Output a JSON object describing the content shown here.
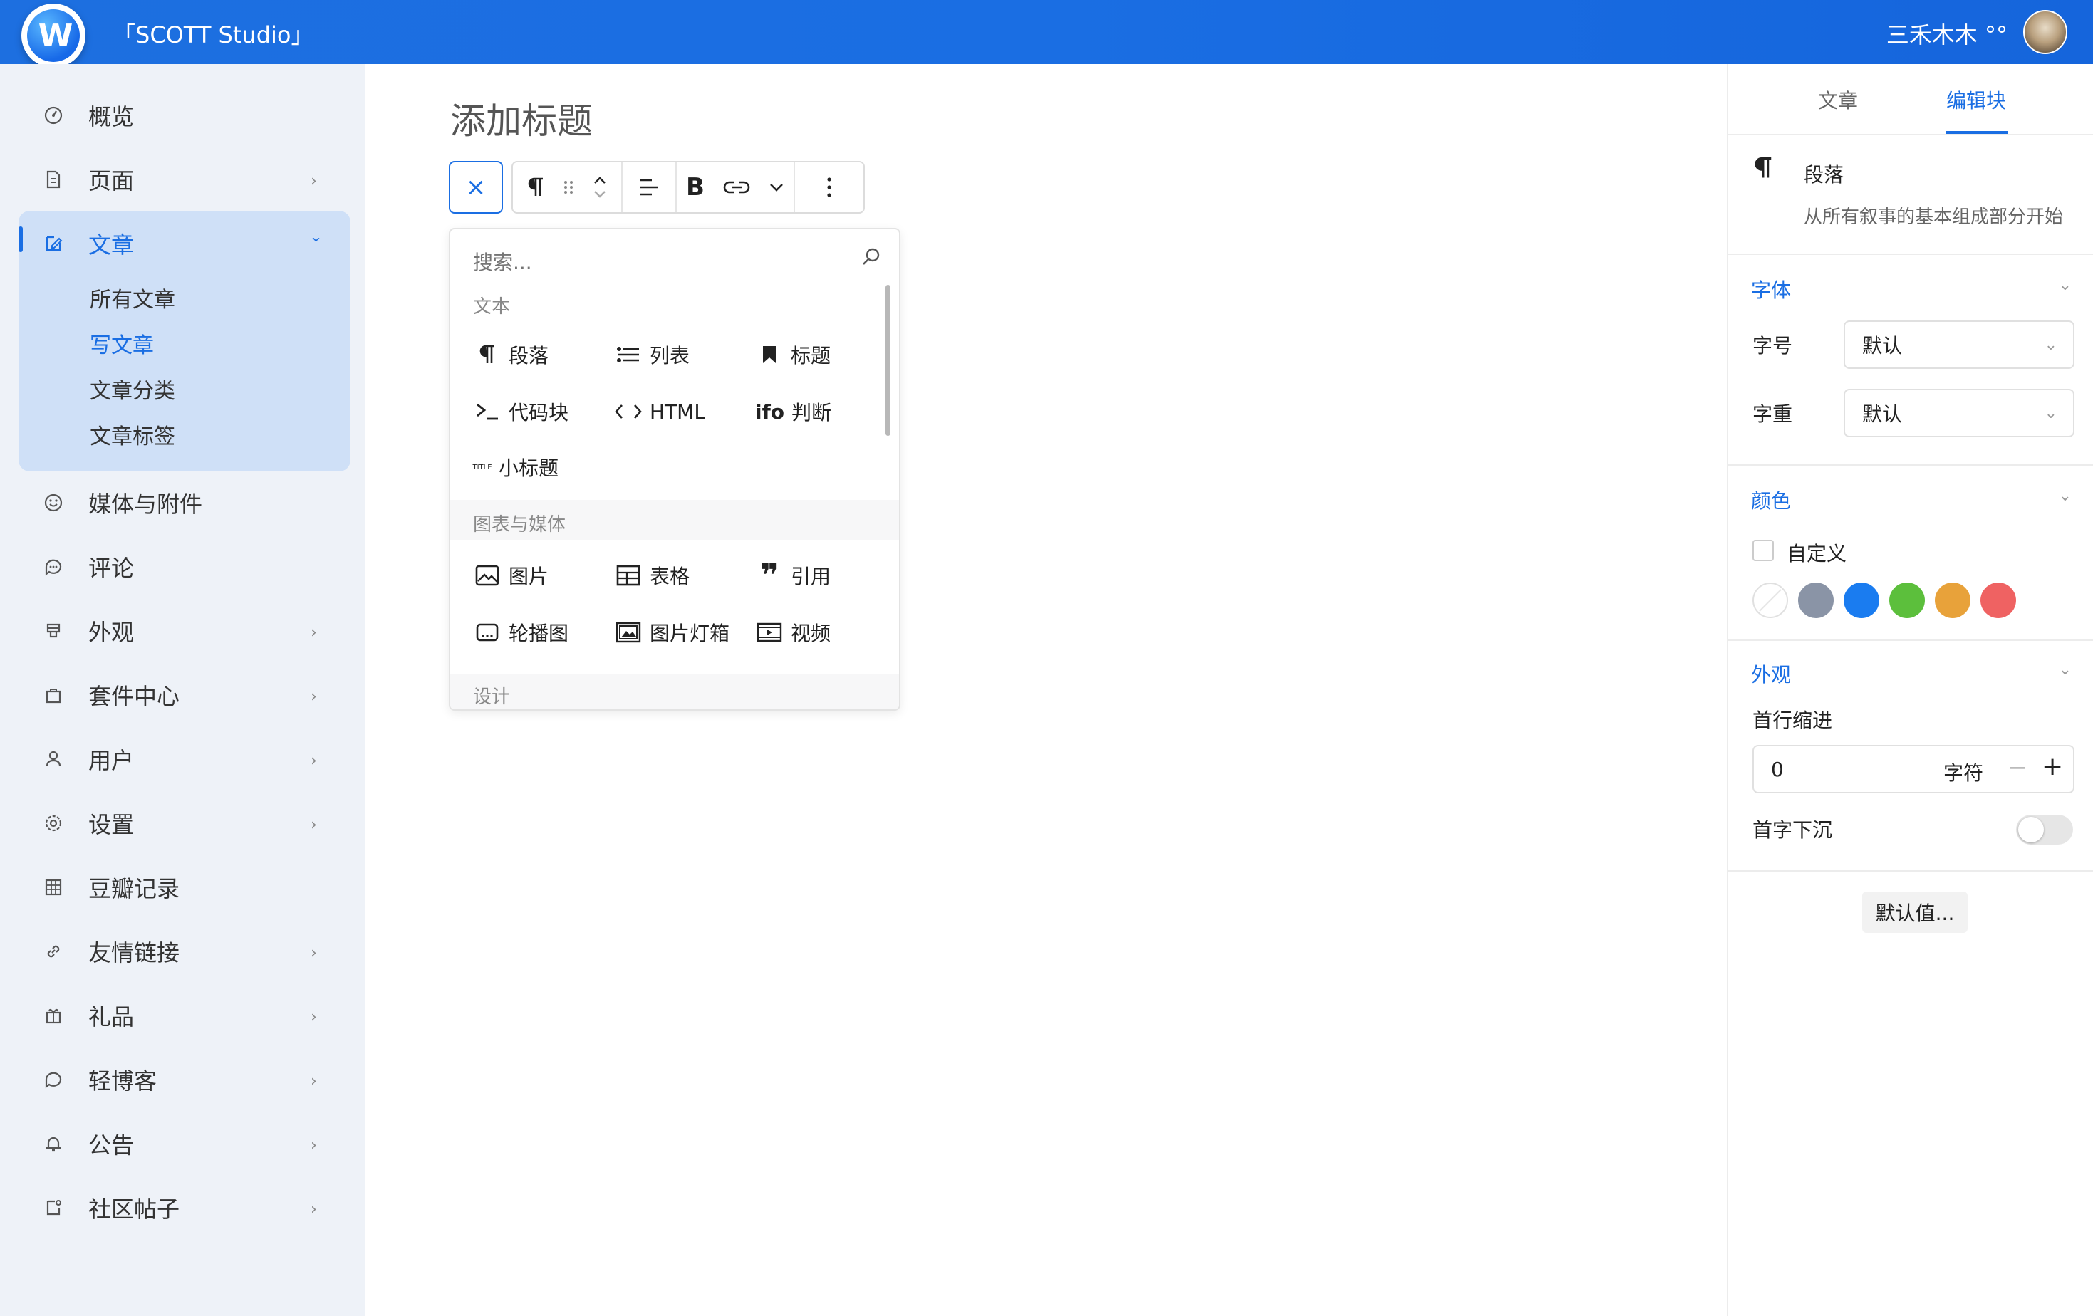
{
  "header": {
    "site_title": "「SCOTT Studio」",
    "user_name": "三禾木木 °°"
  },
  "sidebar": {
    "items": [
      {
        "label": "概览",
        "icon": "dashboard-icon",
        "has_children": false
      },
      {
        "label": "页面",
        "icon": "page-icon",
        "has_children": true
      },
      {
        "label": "文章",
        "icon": "edit-icon",
        "has_children": true,
        "active": true
      },
      {
        "label": "媒体与附件",
        "icon": "media-icon",
        "has_children": false
      },
      {
        "label": "评论",
        "icon": "comment-icon",
        "has_children": false
      },
      {
        "label": "外观",
        "icon": "appearance-icon",
        "has_children": true
      },
      {
        "label": "套件中心",
        "icon": "bag-icon",
        "has_children": true
      },
      {
        "label": "用户",
        "icon": "user-icon",
        "has_children": true
      },
      {
        "label": "设置",
        "icon": "settings-icon",
        "has_children": true
      },
      {
        "label": "豆瓣记录",
        "icon": "grid-icon",
        "has_children": false
      },
      {
        "label": "友情链接",
        "icon": "link-icon",
        "has_children": true
      },
      {
        "label": "礼品",
        "icon": "gift-icon",
        "has_children": true
      },
      {
        "label": "轻博客",
        "icon": "bubble-icon",
        "has_children": true
      },
      {
        "label": "公告",
        "icon": "bell-icon",
        "has_children": true
      },
      {
        "label": "社区帖子",
        "icon": "post-icon",
        "has_children": true
      }
    ],
    "sub_items": [
      {
        "label": "所有文章",
        "active": false
      },
      {
        "label": "写文章",
        "active": true
      },
      {
        "label": "文章分类",
        "active": false
      },
      {
        "label": "文章标签",
        "active": false
      }
    ]
  },
  "editor": {
    "title_placeholder": "添加标题",
    "close_label": "×"
  },
  "inserter": {
    "search_placeholder": "搜索...",
    "categories": [
      {
        "label": "文本",
        "items": [
          {
            "label": "段落",
            "icon": "paragraph-icon"
          },
          {
            "label": "列表",
            "icon": "list-icon"
          },
          {
            "label": "标题",
            "icon": "bookmark-icon"
          },
          {
            "label": "代码块",
            "icon": "code-block-icon"
          },
          {
            "label": "HTML",
            "icon": "html-icon"
          },
          {
            "label": "判断",
            "icon": "ifo-icon"
          },
          {
            "label": "小标题",
            "icon": "subtitle-icon"
          }
        ]
      },
      {
        "label": "图表与媒体",
        "items": [
          {
            "label": "图片",
            "icon": "image-icon"
          },
          {
            "label": "表格",
            "icon": "table-icon"
          },
          {
            "label": "引用",
            "icon": "quote-icon"
          },
          {
            "label": "轮播图",
            "icon": "carousel-icon"
          },
          {
            "label": "图片灯箱",
            "icon": "lightbox-icon"
          },
          {
            "label": "视频",
            "icon": "video-icon"
          }
        ]
      },
      {
        "label": "设计",
        "items": []
      }
    ]
  },
  "right_panel": {
    "tabs": [
      {
        "label": "文章",
        "active": false
      },
      {
        "label": "编辑块",
        "active": true
      }
    ],
    "block": {
      "name": "段落",
      "description": "从所有叙事的基本组成部分开始"
    },
    "font_section": {
      "title": "字体",
      "size_label": "字号",
      "size_value": "默认",
      "weight_label": "字重",
      "weight_value": "默认"
    },
    "color_section": {
      "title": "颜色",
      "custom_label": "自定义",
      "swatches": [
        "none",
        "#8a94a6",
        "#1a7cf0",
        "#5cbf3c",
        "#e8a23a",
        "#ef6262"
      ]
    },
    "appearance_section": {
      "title": "外观",
      "indent_label": "首行缩进",
      "indent_value": "0",
      "indent_unit": "字符",
      "dropcap_label": "首字下沉",
      "dropcap_on": false
    },
    "default_button": "默认值..."
  },
  "colors": {
    "accent": "#1a6ee3",
    "sidebar_bg": "#eef2f8",
    "sidebar_active_bg": "#cfe0f7"
  }
}
